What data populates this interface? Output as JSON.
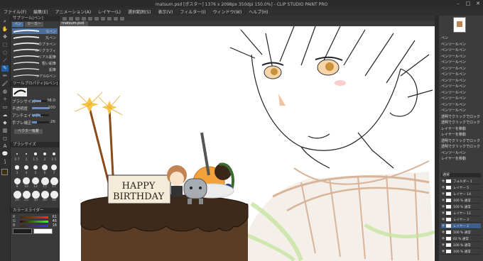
{
  "window": {
    "title": "matsum.psd [ポスター] 1376 x 2098px 350dpi 150.0%] - CLIP STUDIO PAINT PRO",
    "controls": [
      "–",
      "□",
      "✕"
    ]
  },
  "menu": [
    "ファイル(F)",
    "編集(E)",
    "アニメーション(A)",
    "レイヤー(L)",
    "選択範囲(S)",
    "表示(V)",
    "フィルター(I)",
    "ウィンドウ(W)",
    "ヘルプ(H)"
  ],
  "canvas_tab": "matsum.psd",
  "subtool": {
    "header": "サブツール[ペン]",
    "tabs": [
      "ペン",
      "マーカー"
    ],
    "brushes": [
      "Gペン",
      "丸ペン",
      "カブラペン",
      "カリグラフィ",
      "リアル鉛筆",
      "粗い鉛筆",
      "鉛筆",
      "リアルGペン"
    ],
    "detail_header": "ツールプロパティ[Gペン]",
    "properties": [
      {
        "label": "ブラシサイズ",
        "value": "38.0",
        "fill": 0.55
      },
      {
        "label": "不透明度",
        "value": "100",
        "fill": 1.0
      },
      {
        "label": "アンチエイリアス",
        "value": "",
        "fill": 0.5
      },
      {
        "label": "手ブレ補正",
        "value": "26",
        "fill": 0.3
      }
    ],
    "vector_label": "ベクター吸着",
    "size_header": "ブラシサイズ",
    "brush_sizes": [
      "0.7",
      "1",
      "1.5",
      "2",
      "2.5",
      "3",
      "4",
      "5",
      "6",
      "7",
      "8",
      "10",
      "12",
      "15",
      "17",
      "20",
      "25",
      "30",
      "40",
      "50"
    ],
    "color_header": "カラースライダー",
    "color_sliders": [
      {
        "label": "R",
        "value": "61"
      },
      {
        "label": "G",
        "value": "46"
      },
      {
        "label": "B",
        "value": "16"
      }
    ]
  },
  "artwork": {
    "cake_text_line1": "HAPPY",
    "cake_text_line2": "BIRTHDAY"
  },
  "right_panel": {
    "property_rows": [
      "ペン",
      "ベンツールペン",
      "ペンツールペン",
      "ペンツールペン",
      "ペンツールペン",
      "ペンツールペン",
      "ペンツールペン",
      "ペンツールペン",
      "ペンツールペン",
      "ペンツールペン",
      "ペンツールペン",
      "ペンツールペン",
      "ペンツールペン",
      "透明でクリックでロックが外れます",
      "透明でクリックでロックが外れます",
      "レイヤーを移動",
      "レイヤーを移動",
      "透明でクリックでロックが外れます",
      "透明でクリックでロックが外れます",
      "ペンツールペン",
      "レイヤーを移動"
    ],
    "layer_blend": "通常",
    "layers": [
      "フォルダー 1",
      "レイヤー 5",
      "レイヤー 14",
      "100 % 通常",
      "100 % 通常",
      "レイヤー 11",
      "レイヤー 3",
      "レイヤー 2",
      "100 % 通常",
      "62 % 通常",
      "100 % 通常",
      "100 % 通常"
    ],
    "selected_layer_index": 7
  }
}
